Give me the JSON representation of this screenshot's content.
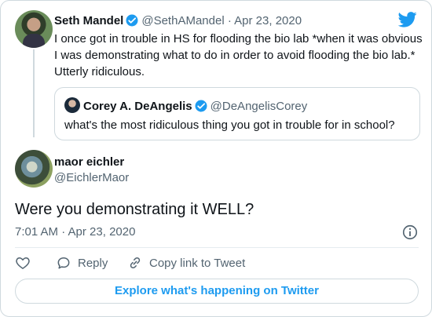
{
  "parent_tweet": {
    "author_name": "Seth Mandel",
    "handle": "@SethAMandel",
    "separator": "·",
    "date": "Apr 23, 2020",
    "text": "I once got in trouble in HS for flooding the bio lab *when it was obvious I was demonstrating what to do in order to avoid flooding the bio lab.* Utterly ridiculous."
  },
  "quoted_tweet": {
    "author_name": "Corey A. DeAngelis",
    "handle": "@DeAngelisCorey",
    "text": "what's the most ridiculous thing you got in trouble for in school?"
  },
  "main_tweet": {
    "author_name": "maor eichler",
    "handle": "@EichlerMaor",
    "text": "Were you demonstrating it WELL?",
    "timestamp": "7:01 AM · Apr 23, 2020"
  },
  "actions": {
    "reply_label": "Reply",
    "copy_label": "Copy link to Tweet"
  },
  "footer": {
    "explore_label": "Explore what's happening on Twitter"
  },
  "icons": {
    "verified": "verified-badge-icon",
    "twitter": "twitter-bird-icon",
    "info": "info-icon",
    "like": "heart-icon",
    "reply": "reply-bubble-icon",
    "copy": "link-icon"
  },
  "colors": {
    "accent": "#1d9bf0",
    "secondary_text": "#536471",
    "border": "#cfd9de"
  }
}
